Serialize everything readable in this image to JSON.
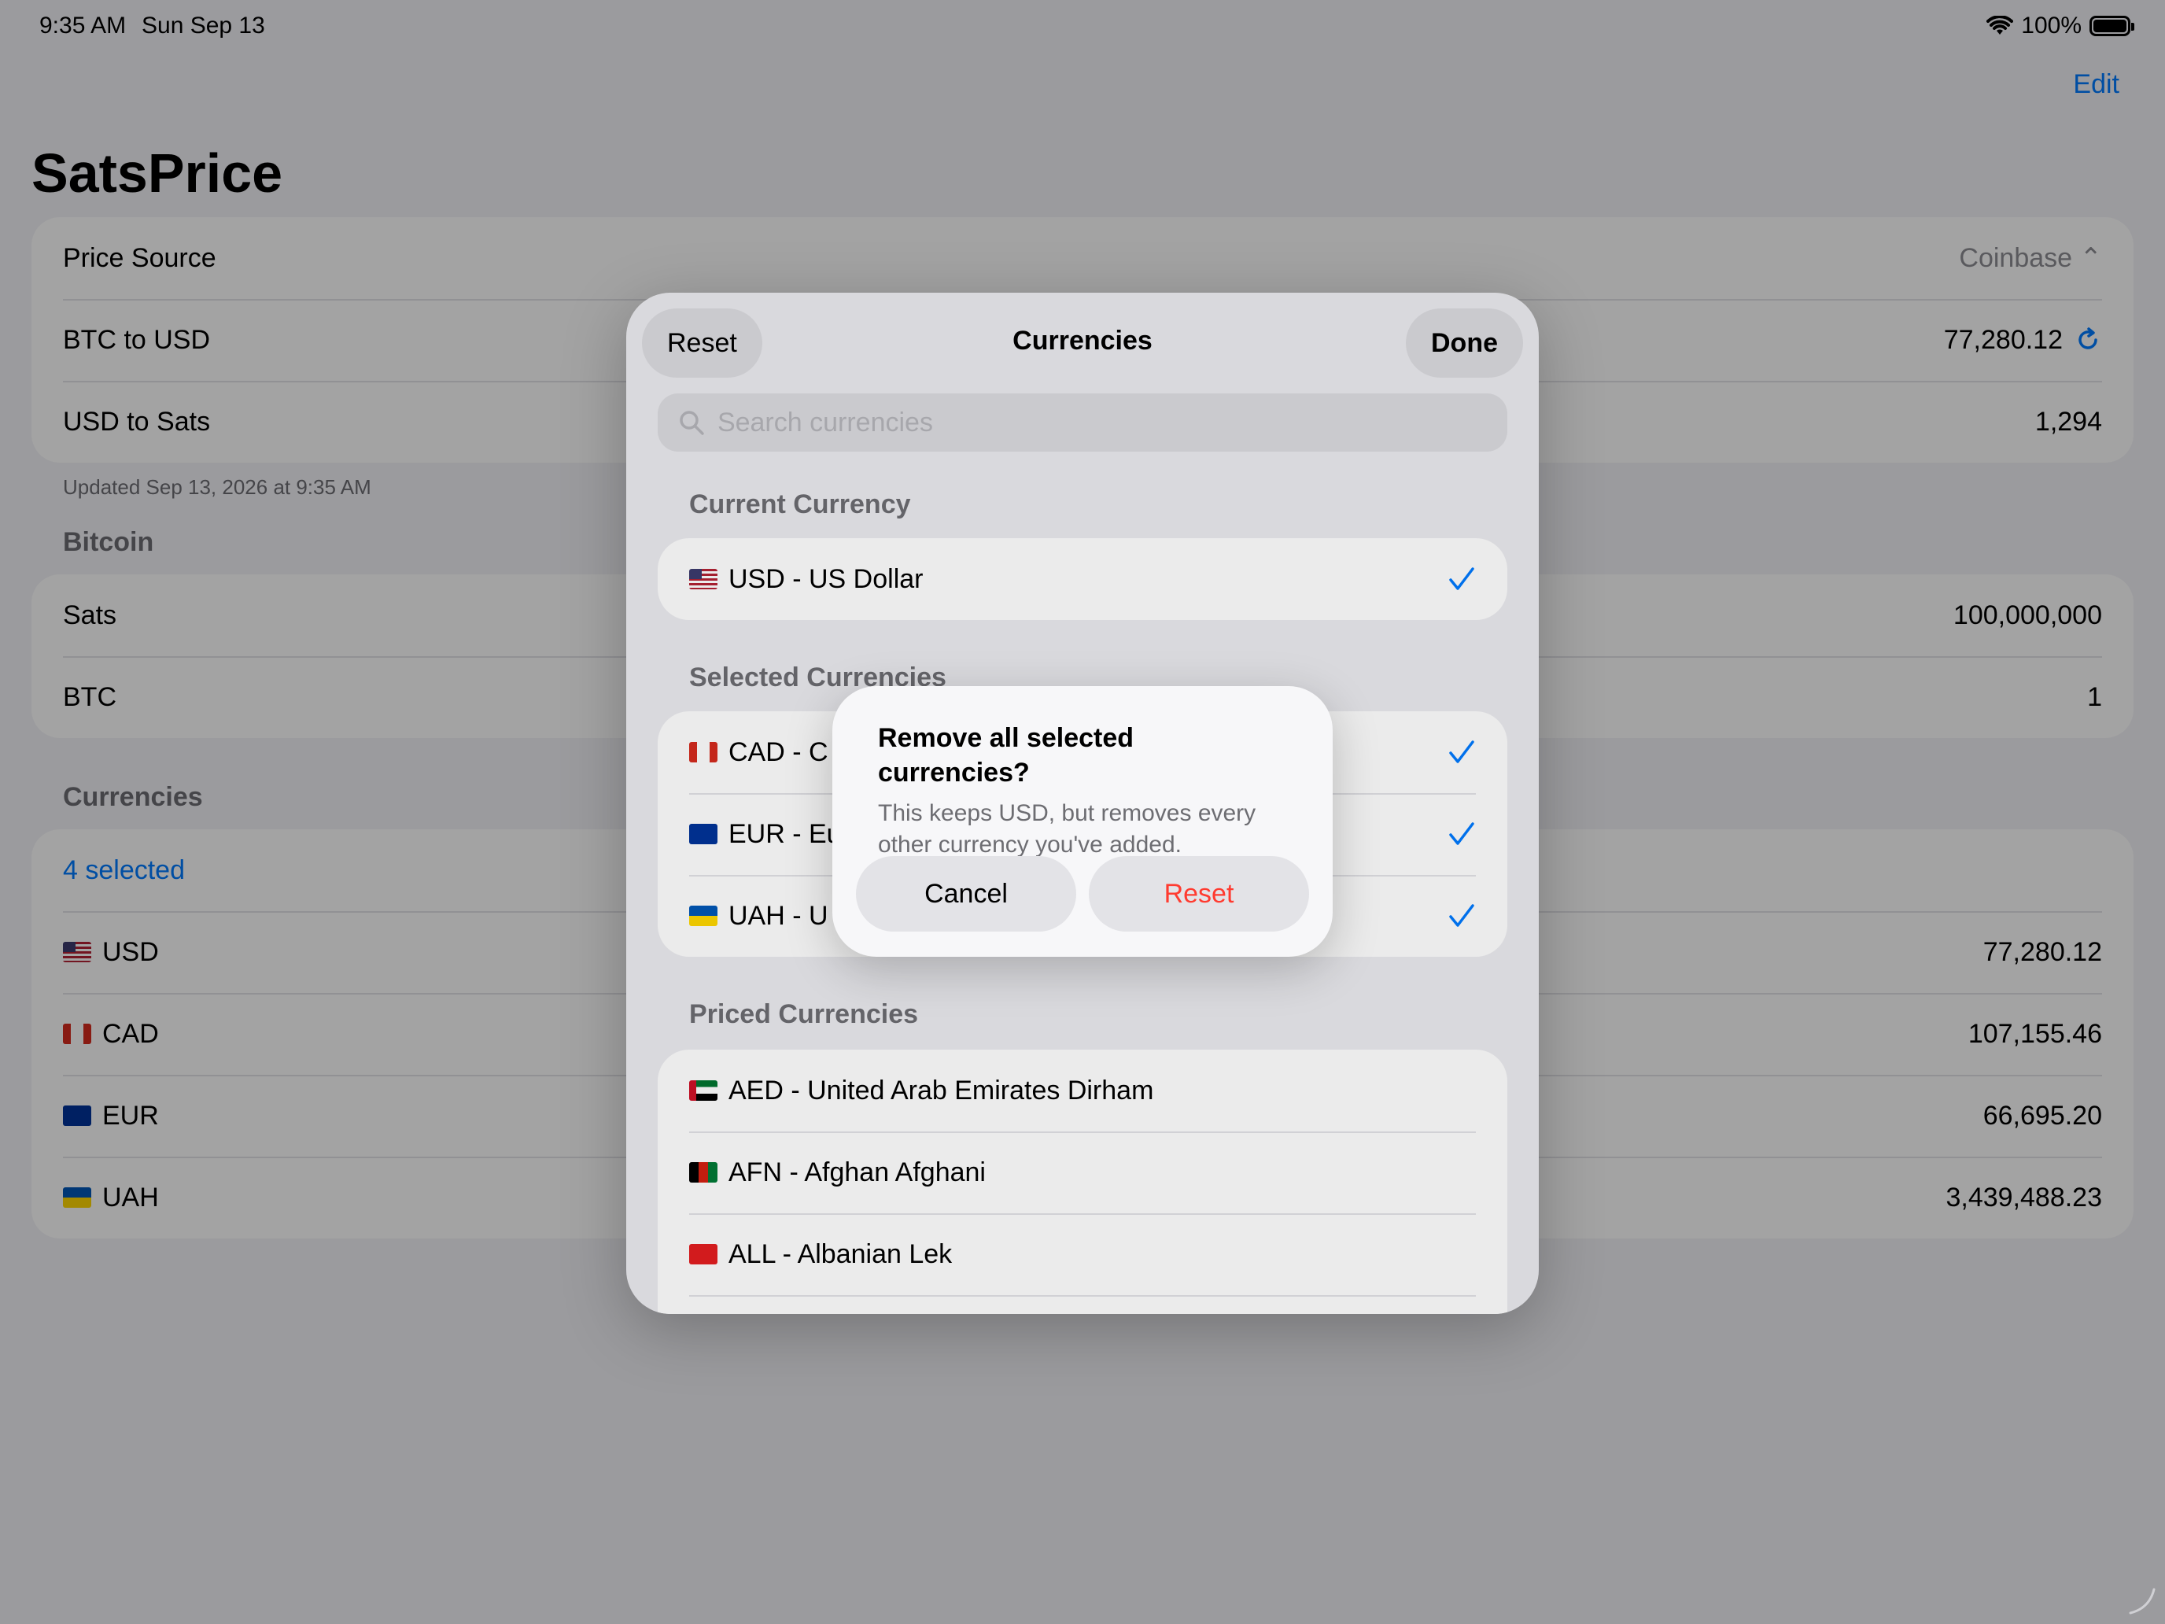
{
  "status_bar": {
    "time": "9:35 AM",
    "date": "Sun Sep 13",
    "battery": "100%"
  },
  "nav": {
    "edit_label": "Edit",
    "title": "SatsPrice"
  },
  "price_group": {
    "source_label": "Price Source",
    "source_value": "Coinbase ⌃",
    "btc_usd_label": "BTC to USD",
    "btc_usd_value": "77,280.12",
    "usd_sats_label": "USD to Sats",
    "usd_sats_value": "1,294"
  },
  "updated_text": "Updated Sep 13, 2026 at 9:35 AM",
  "bitcoin_section": {
    "header": "Bitcoin",
    "sats_label": "Sats",
    "sats_value": "100,000,000",
    "btc_label": "BTC",
    "btc_value": "1"
  },
  "currencies_section": {
    "header": "Currencies",
    "selected_label": "4 selected",
    "rows": [
      {
        "code": "USD",
        "value": "77,280.12"
      },
      {
        "code": "CAD",
        "value": "107,155.46"
      },
      {
        "code": "EUR",
        "value": "66,695.20"
      },
      {
        "code": "UAH",
        "value": "3,439,488.23"
      }
    ]
  },
  "sheet": {
    "reset_label": "Reset",
    "title": "Currencies",
    "done_label": "Done",
    "search_placeholder": "Search currencies",
    "current_header": "Current Currency",
    "current": "USD - US Dollar",
    "selected_header": "Selected Currencies",
    "selected": [
      "CAD - C",
      "EUR - Eu",
      "UAH - U"
    ],
    "priced_header": "Priced Currencies",
    "priced": [
      "AED - United Arab Emirates Dirham",
      "AFN - Afghan Afghani",
      "ALL - Albanian Lek"
    ]
  },
  "alert": {
    "title": "Remove all selected currencies?",
    "message": "This keeps USD, but removes every other currency you've added.",
    "cancel_label": "Cancel",
    "reset_label": "Reset"
  },
  "colors": {
    "accent": "#007aff",
    "destructive": "#ff3b30"
  }
}
